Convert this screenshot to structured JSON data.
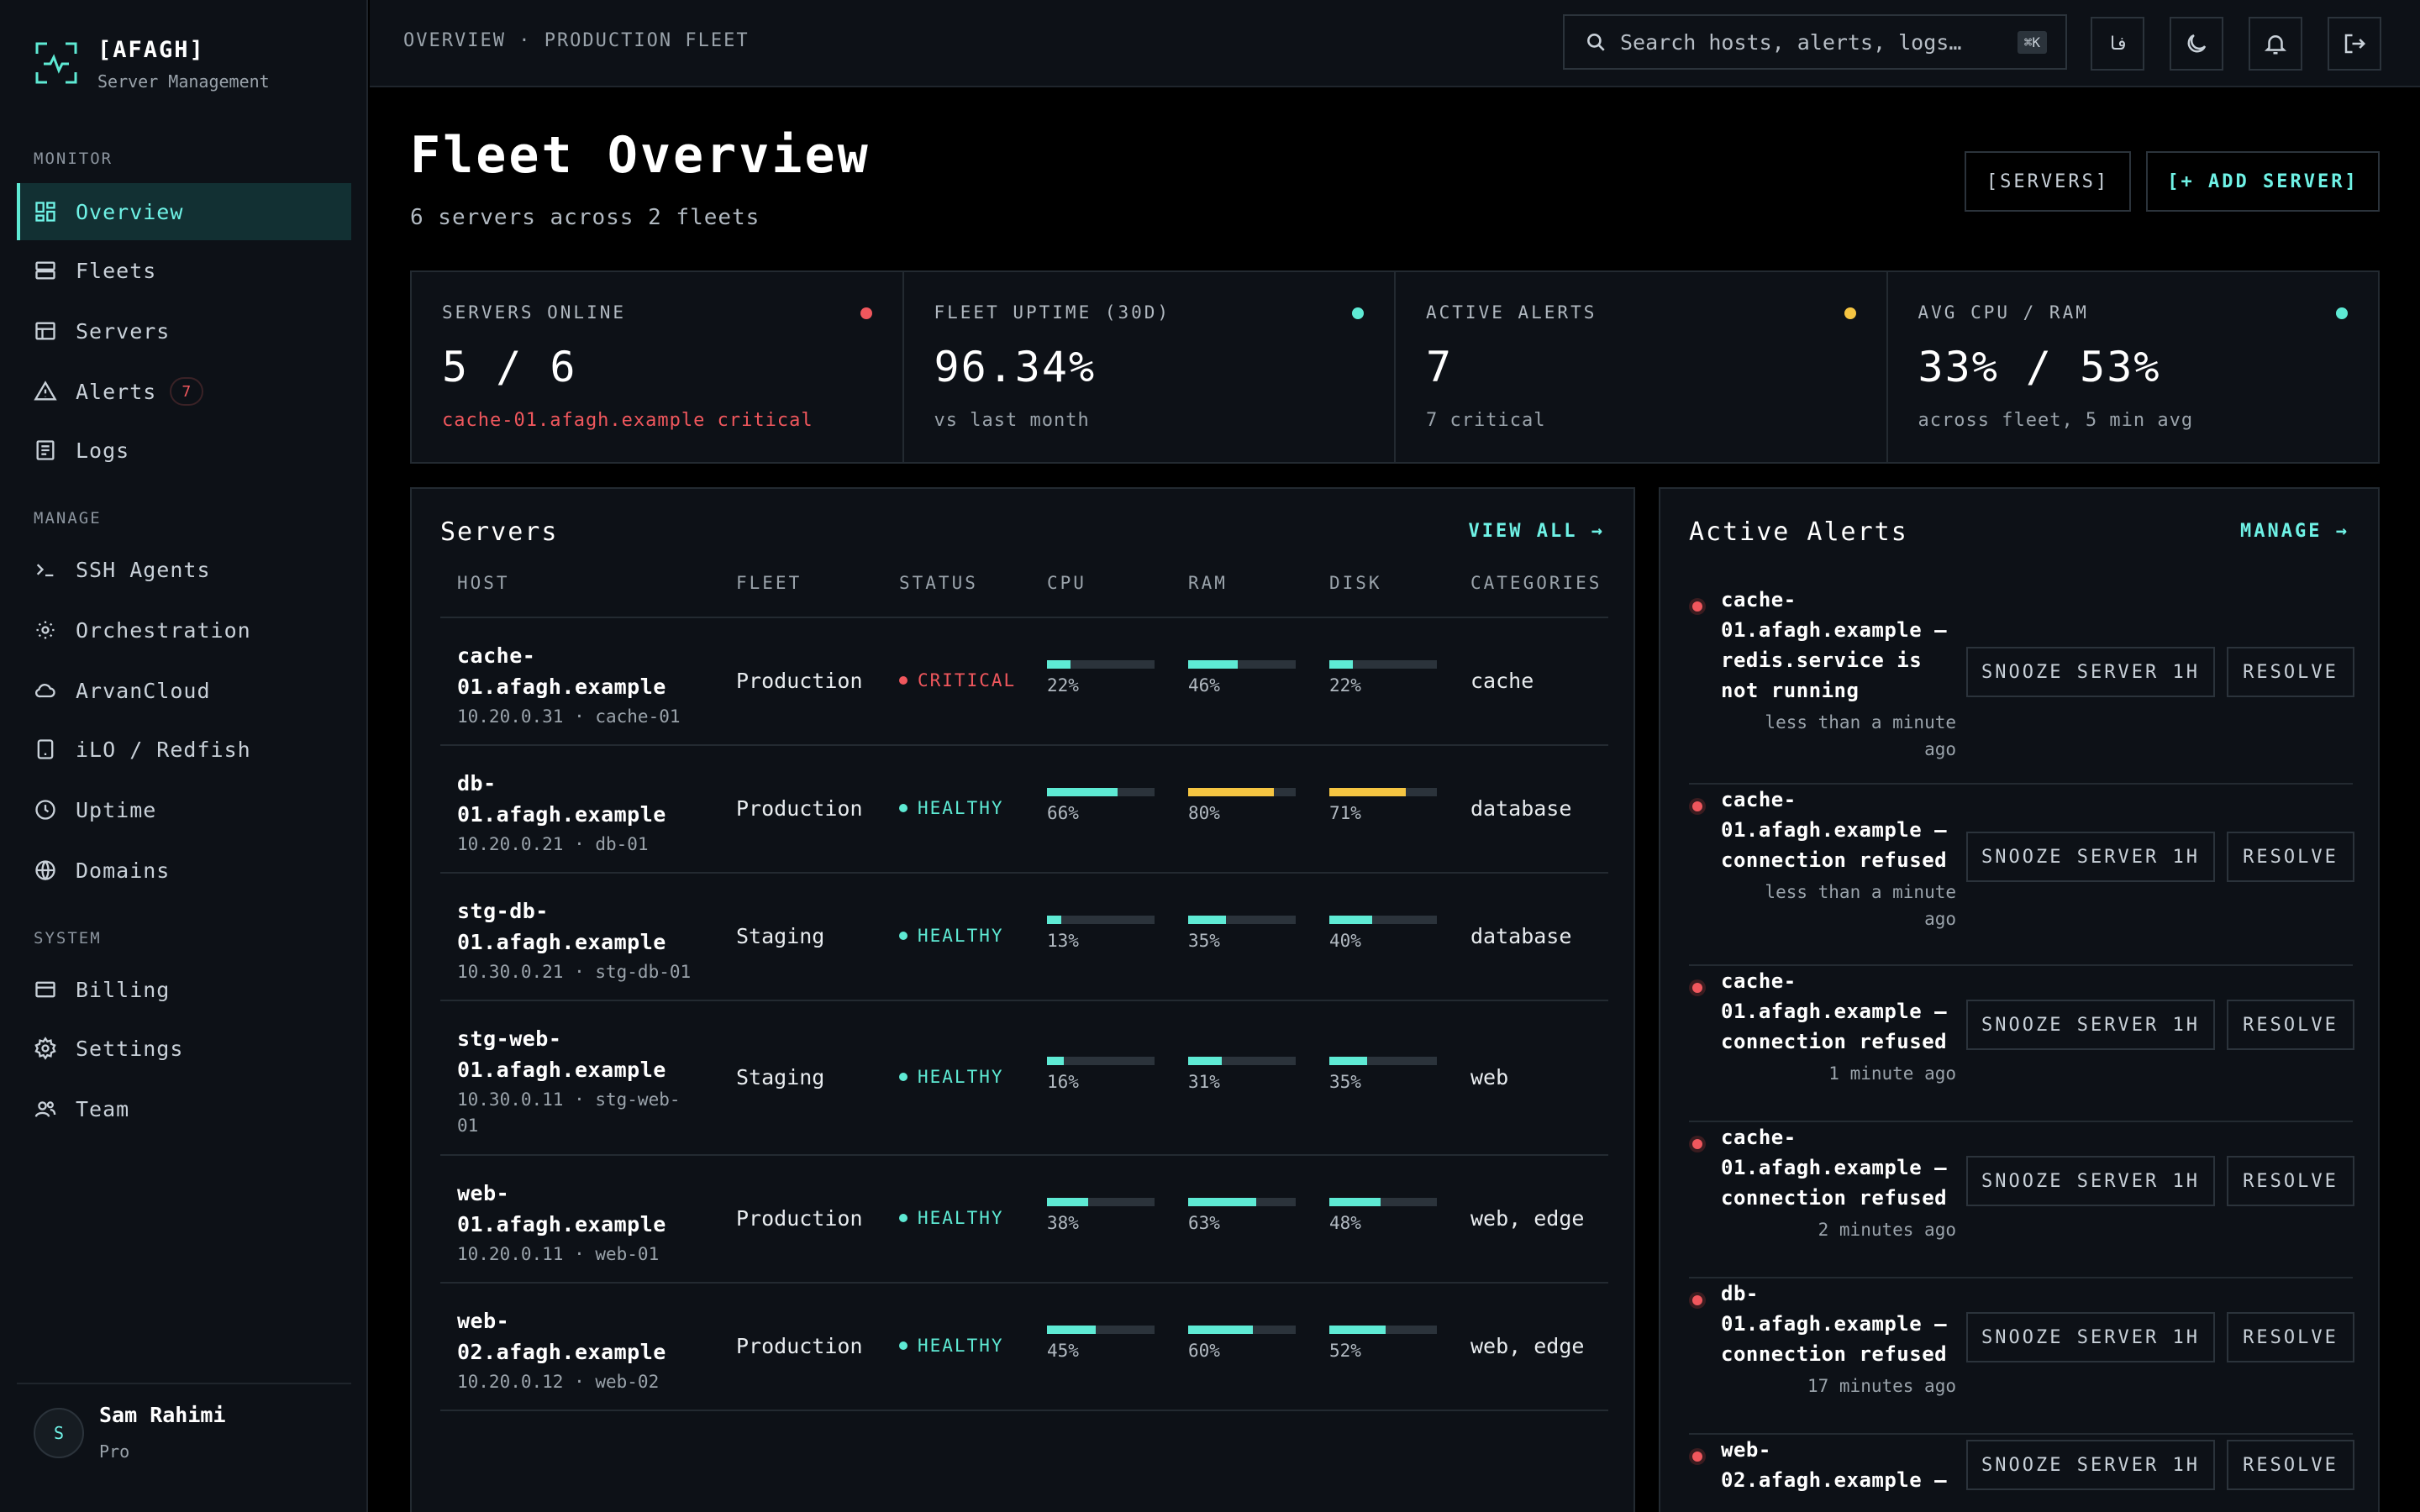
{
  "brand": {
    "name": "[AFAGH]",
    "subtitle": "Server Management"
  },
  "sidebar": {
    "sections": {
      "monitor": "MONITOR",
      "manage": "MANAGE",
      "system": "SYSTEM"
    },
    "items": [
      {
        "label": "Overview",
        "icon": "grid-icon",
        "active": true
      },
      {
        "label": "Fleets",
        "icon": "server-stack-icon"
      },
      {
        "label": "Servers",
        "icon": "table-icon"
      },
      {
        "label": "Alerts",
        "icon": "alert-triangle-icon",
        "badge": "7"
      },
      {
        "label": "Logs",
        "icon": "file-text-icon"
      },
      {
        "label": "SSH Agents",
        "icon": "terminal-icon"
      },
      {
        "label": "Orchestration",
        "icon": "sun-icon"
      },
      {
        "label": "ArvanCloud",
        "icon": "cloud-icon"
      },
      {
        "label": "iLO / Redfish",
        "icon": "tablet-icon"
      },
      {
        "label": "Uptime",
        "icon": "clock-icon"
      },
      {
        "label": "Domains",
        "icon": "globe-icon"
      },
      {
        "label": "Billing",
        "icon": "credit-card-icon"
      },
      {
        "label": "Settings",
        "icon": "gear-icon"
      },
      {
        "label": "Team",
        "icon": "users-icon"
      }
    ]
  },
  "user": {
    "initial": "S",
    "name": "Sam Rahimi",
    "plan": "Pro"
  },
  "topbar": {
    "breadcrumb": "OVERVIEW · PRODUCTION FLEET",
    "search_placeholder": "Search hosts, alerts, logs…",
    "search_shortcut": "⌘K",
    "lang_label": "فا"
  },
  "header": {
    "title": "Fleet Overview",
    "subtitle": "6 servers across 2 fleets",
    "servers_button": "[SERVERS]",
    "add_button": "[+ ADD SERVER]"
  },
  "stats": [
    {
      "label": "SERVERS ONLINE",
      "value": "5 / 6",
      "note": "cache-01.afagh.example critical",
      "dot_color": "#f0575d",
      "note_alert": true
    },
    {
      "label": "FLEET UPTIME (30D)",
      "value": "96.34%",
      "note": "vs last month",
      "dot_color": "#5eead4"
    },
    {
      "label": "ACTIVE ALERTS",
      "value": "7",
      "note": "7 critical",
      "dot_color": "#f5c542"
    },
    {
      "label": "AVG CPU / RAM",
      "value": "33% / 53%",
      "note": "across fleet, 5 min avg",
      "dot_color": "#5eead4"
    }
  ],
  "servers_panel": {
    "title": "Servers",
    "link": "VIEW ALL →",
    "columns": [
      "HOST",
      "FLEET",
      "STATUS",
      "CPU",
      "RAM",
      "DISK",
      "CATEGORIES"
    ],
    "rows": [
      {
        "host_lines": [
          "cache-",
          "01.afagh.example"
        ],
        "meta_lines": [
          "10.20.0.31 · cache-01"
        ],
        "fleet": "Production",
        "status": "CRITICAL",
        "status_color": "#f0575d",
        "cpu": 22,
        "ram": 46,
        "disk": 22,
        "cpu_label": "22%",
        "ram_label": "46%",
        "disk_label": "22%",
        "categories": "cache"
      },
      {
        "host_lines": [
          "db-",
          "01.afagh.example"
        ],
        "meta_lines": [
          "10.20.0.21 · db-01"
        ],
        "fleet": "Production",
        "status": "HEALTHY",
        "status_color": "#5eead4",
        "cpu": 66,
        "ram": 80,
        "disk": 71,
        "cpu_label": "66%",
        "ram_label": "80%",
        "disk_label": "71%",
        "categories": "database"
      },
      {
        "host_lines": [
          "stg-db-",
          "01.afagh.example"
        ],
        "meta_lines": [
          "10.30.0.21 · stg-db-01"
        ],
        "fleet": "Staging",
        "status": "HEALTHY",
        "status_color": "#5eead4",
        "cpu": 13,
        "ram": 35,
        "disk": 40,
        "cpu_label": "13%",
        "ram_label": "35%",
        "disk_label": "40%",
        "categories": "database"
      },
      {
        "host_lines": [
          "stg-web-",
          "01.afagh.example"
        ],
        "meta_lines": [
          "10.30.0.11 · stg-web-",
          "01"
        ],
        "fleet": "Staging",
        "status": "HEALTHY",
        "status_color": "#5eead4",
        "cpu": 16,
        "ram": 31,
        "disk": 35,
        "cpu_label": "16%",
        "ram_label": "31%",
        "disk_label": "35%",
        "categories": "web"
      },
      {
        "host_lines": [
          "web-",
          "01.afagh.example"
        ],
        "meta_lines": [
          "10.20.0.11 · web-01"
        ],
        "fleet": "Production",
        "status": "HEALTHY",
        "status_color": "#5eead4",
        "cpu": 38,
        "ram": 63,
        "disk": 48,
        "cpu_label": "38%",
        "ram_label": "63%",
        "disk_label": "48%",
        "categories": "web, edge"
      },
      {
        "host_lines": [
          "web-",
          "02.afagh.example"
        ],
        "meta_lines": [
          "10.20.0.12 · web-02"
        ],
        "fleet": "Production",
        "status": "HEALTHY",
        "status_color": "#5eead4",
        "cpu": 45,
        "ram": 60,
        "disk": 52,
        "cpu_label": "45%",
        "ram_label": "60%",
        "disk_label": "52%",
        "categories": "web, edge"
      }
    ]
  },
  "alerts_panel": {
    "title": "Active Alerts",
    "link": "MANAGE →",
    "snooze_label": "SNOOZE SERVER 1H",
    "resolve_label": "RESOLVE",
    "alerts": [
      {
        "message_lines": [
          "cache-",
          "01.afagh.example —",
          "redis.service is",
          "not running"
        ],
        "time_lines": [
          "less than a minute",
          "ago"
        ]
      },
      {
        "message_lines": [
          "cache-",
          "01.afagh.example —",
          "connection refused"
        ],
        "time_lines": [
          "less than a minute",
          "ago"
        ]
      },
      {
        "message_lines": [
          "cache-",
          "01.afagh.example —",
          "connection refused"
        ],
        "time_lines": [
          "1 minute ago"
        ]
      },
      {
        "message_lines": [
          "cache-",
          "01.afagh.example —",
          "connection refused"
        ],
        "time_lines": [
          "2 minutes ago"
        ]
      },
      {
        "message_lines": [
          "db-",
          "01.afagh.example —",
          "connection refused"
        ],
        "time_lines": [
          "17 minutes ago"
        ]
      },
      {
        "message_lines": [
          "web-",
          "02.afagh.example —"
        ],
        "time_lines": []
      }
    ]
  },
  "colors": {
    "accent": "#5eead4",
    "critical": "#f0575d",
    "warning": "#f5c542",
    "bar_track": "#2b333b"
  }
}
